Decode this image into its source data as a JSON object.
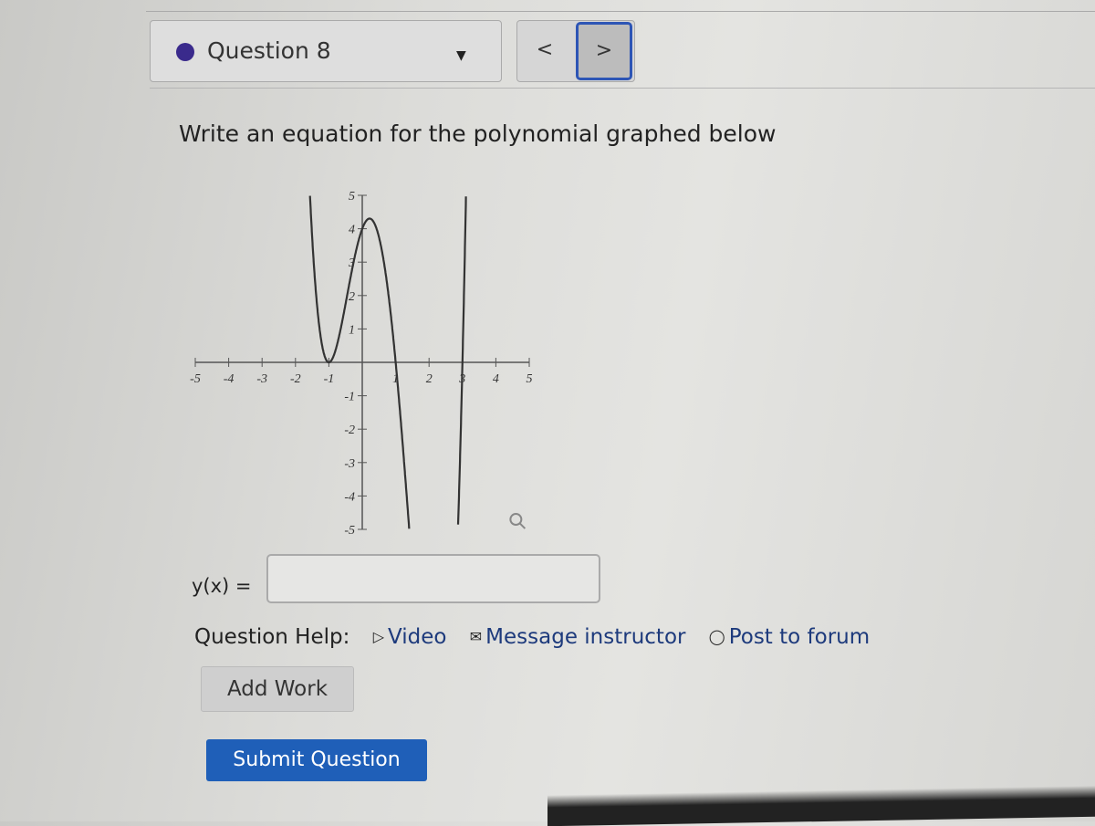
{
  "header": {
    "question_label": "Question 8",
    "status_color": "#3a2a8c",
    "dropdown_icon": "caret-down-icon",
    "prev_label": "<",
    "next_label": ">",
    "accent": "#2d55b5"
  },
  "prompt": "Write an equation for the polynomial graphed below",
  "chart_data": {
    "type": "line",
    "xlim": [
      -5,
      5
    ],
    "ylim": [
      -5,
      5
    ],
    "x_ticks": [
      "-5",
      "-4",
      "-3",
      "-2",
      "-1",
      "1",
      "2",
      "3",
      "4",
      "5"
    ],
    "y_ticks": [
      "5",
      "4",
      "3",
      "2",
      "1",
      "-1",
      "-2",
      "-3",
      "-4",
      "-5"
    ],
    "x_intercepts": [
      -1,
      1,
      3
    ],
    "double_root": -1,
    "y_intercept": 4,
    "local_max": [
      0.1,
      4.3
    ],
    "zoom_icon": "magnifier-icon"
  },
  "answer": {
    "label": "y(x) =",
    "value": ""
  },
  "help": {
    "label": "Question Help:",
    "video": "Video",
    "message": "Message instructor",
    "forum": "Post to forum"
  },
  "buttons": {
    "add_work": "Add Work",
    "submit": "Submit Question",
    "submit_color": "#1f5fb8"
  }
}
